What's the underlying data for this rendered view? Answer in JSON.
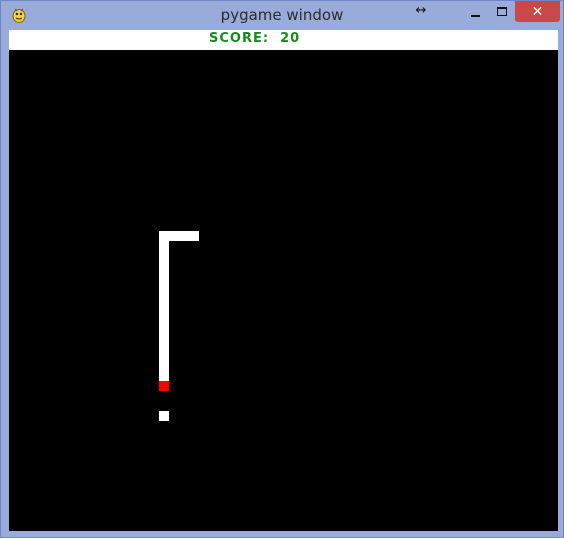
{
  "window": {
    "title": "pygame window",
    "app_icon": "pygame-snake-icon",
    "resize_icon": "↔",
    "close_glyph": "✕"
  },
  "game": {
    "score_text": "SCORE:  20",
    "score_value": 20,
    "background_color": "#000000",
    "score_bar_color": "#ffffff",
    "score_text_color": "#1a8a1a",
    "snake_color": "#ffffff",
    "head_color": "#ff0000",
    "food_color": "#ffffff"
  }
}
